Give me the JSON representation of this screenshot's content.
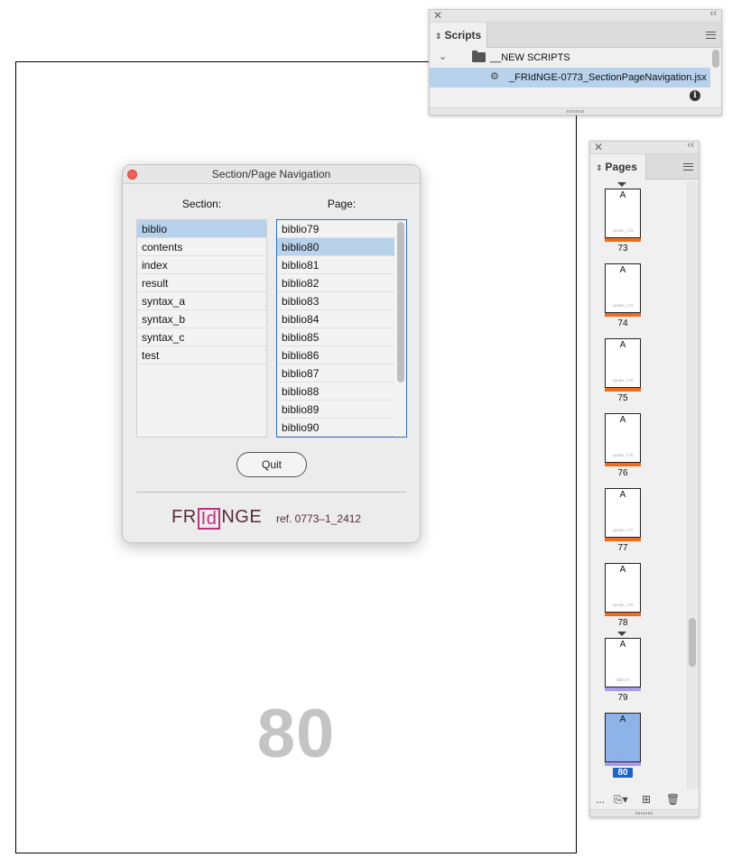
{
  "document": {
    "page_number": "80"
  },
  "scripts_panel": {
    "tab_label": "Scripts",
    "folder_label": "__NEW SCRIPTS",
    "script_label": "_FRIdNGE-0773_SectionPageNavigation.jsx"
  },
  "pages_panel": {
    "tab_label": "Pages",
    "footer_more": "...",
    "thumbnails": [
      {
        "master": "A",
        "mini": "syntax_c73",
        "number": "73",
        "stripe_color": "#ef6b1e",
        "section_start": true,
        "selected": false
      },
      {
        "master": "A",
        "mini": "syntax_c74",
        "number": "74",
        "stripe_color": "#ef6b1e",
        "section_start": false,
        "selected": false
      },
      {
        "master": "A",
        "mini": "syntax_c75",
        "number": "75",
        "stripe_color": "#ef6b1e",
        "section_start": false,
        "selected": false
      },
      {
        "master": "A",
        "mini": "syntax_c76",
        "number": "76",
        "stripe_color": "#ef6b1e",
        "section_start": false,
        "selected": false
      },
      {
        "master": "A",
        "mini": "syntax_c77",
        "number": "77",
        "stripe_color": "#ef6b1e",
        "section_start": false,
        "selected": false
      },
      {
        "master": "A",
        "mini": "syntax_c78",
        "number": "78",
        "stripe_color": "#ef6b1e",
        "section_start": false,
        "selected": false
      },
      {
        "master": "A",
        "mini": "biblio79",
        "number": "79",
        "stripe_color": "#a79be8",
        "section_start": true,
        "selected": false
      },
      {
        "master": "A",
        "mini": "80",
        "number": "80",
        "stripe_color": "#a79be8",
        "section_start": false,
        "selected": true
      }
    ]
  },
  "dialog": {
    "title": "Section/Page Navigation",
    "section_label": "Section:",
    "page_label": "Page:",
    "sections": [
      "biblio",
      "contents",
      "index",
      "result",
      "syntax_a",
      "syntax_b",
      "syntax_c",
      "test"
    ],
    "selected_section": "biblio",
    "pages": [
      "biblio79",
      "biblio80",
      "biblio81",
      "biblio82",
      "biblio83",
      "biblio84",
      "biblio85",
      "biblio86",
      "biblio87",
      "biblio88",
      "biblio89",
      "biblio90"
    ],
    "selected_page": "biblio80",
    "quit_label": "Quit",
    "logo_left": "FR",
    "logo_id": "Id",
    "logo_right": "NGE",
    "ref_text": "ref. 0773–1_2412"
  }
}
